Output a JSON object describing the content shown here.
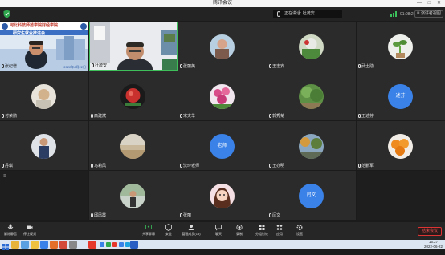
{
  "window": {
    "title": "腾讯会议",
    "controls": "— □ ✕"
  },
  "topbar": {
    "speaking_label": "正在讲话: 杜茂安",
    "timer": "01:08:21",
    "view_button": "Ⅲ 演讲者视图"
  },
  "participants": [
    {
      "name": "张纪增",
      "kind": "video"
    },
    {
      "name": "杜茂安",
      "kind": "video"
    },
    {
      "name": "张丽英",
      "kind": "photo"
    },
    {
      "name": "王志安",
      "kind": "photo"
    },
    {
      "name": "武士勋",
      "kind": "photo"
    },
    {
      "name": "付荣鹏",
      "kind": "photo"
    },
    {
      "name": "高建斌",
      "kind": "photo"
    },
    {
      "name": "宋文华",
      "kind": "photo"
    },
    {
      "name": "郭秀菊",
      "kind": "photo"
    },
    {
      "name": "王述芬",
      "kind": "text",
      "avatar_text": "述芬"
    },
    {
      "name": "丹琪",
      "kind": "photo"
    },
    {
      "name": "马莉风",
      "kind": "photo"
    },
    {
      "name": "沈玲老师",
      "kind": "text",
      "avatar_text": "老师"
    },
    {
      "name": "王亦明",
      "kind": "photo"
    },
    {
      "name": "范鹏军",
      "kind": "photo"
    },
    {
      "name": "邱凤霞",
      "kind": "photo"
    },
    {
      "name": "张丽",
      "kind": "photo"
    },
    {
      "name": "闫文",
      "kind": "text",
      "avatar_text": "闫文"
    }
  ],
  "slide": {
    "school": "河北科技师范学院财经学院",
    "banner": "研究生就业推进会",
    "date": "2022年6月22日"
  },
  "toolbar": {
    "items": [
      "解除静音",
      "停止视频",
      "共享屏幕",
      "安全",
      "管理成员(18)",
      "聊天",
      "录制",
      "分组讨论",
      "应用",
      "设置"
    ],
    "end_button": "结束会议"
  },
  "taskbar": {
    "time": "15:27",
    "date": "2022-06-22"
  },
  "colors": {
    "avatar_blue": "#3b82e8",
    "end_red": "#e04444",
    "background": "#1b1b1b"
  }
}
